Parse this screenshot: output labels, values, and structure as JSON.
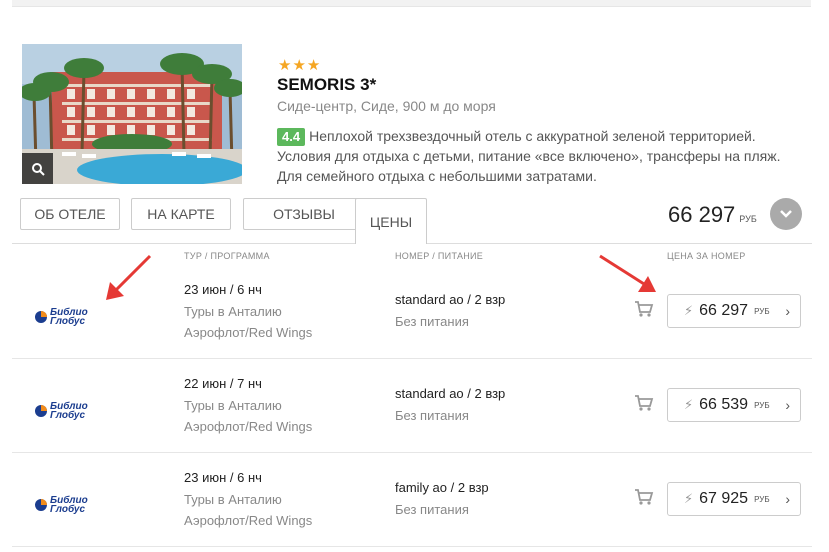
{
  "hotel": {
    "stars": "★★★",
    "name": "SEMORIS 3*",
    "location": "Сиде-центр, Сиде, 900 м до моря",
    "rating": "4.4",
    "description": "Неплохой трехзвездочный отель с аккуратной зеленой территорией. Условия для отдыха с детьми, питание «все включено», трансферы на пляж. Для семейного отдыха с небольшими затратами."
  },
  "tabs": [
    "ОБ ОТЕЛЕ",
    "НА КАРТЕ",
    "ОТЗЫВЫ",
    "ЦЕНЫ"
  ],
  "summary": {
    "price": "66 297",
    "currency": "РУБ"
  },
  "columns": {
    "tour": "ТУР / ПРОГРАММА",
    "room": "НОМЕР / ПИТАНИЕ",
    "price": "ЦЕНА ЗА НОМЕР"
  },
  "offers": [
    {
      "operator": "Библио Глобус",
      "operator_line1": "Библио",
      "operator_line2": "Глобус",
      "dates": "23 июн / 6 нч",
      "program": "Туры в Анталию",
      "airline": "Аэрофлот/Red Wings",
      "room": "standard ао / 2 взр",
      "meal": "Без питания",
      "price": "66 297",
      "currency": "РУБ"
    },
    {
      "operator": "Библио Глобус",
      "operator_line1": "Библио",
      "operator_line2": "Глобус",
      "dates": "22 июн / 7 нч",
      "program": "Туры в Анталию",
      "airline": "Аэрофлот/Red Wings",
      "room": "standard ао / 2 взр",
      "meal": "Без питания",
      "price": "66 539",
      "currency": "РУБ"
    },
    {
      "operator": "Библио Глобус",
      "operator_line1": "Библио",
      "operator_line2": "Глобус",
      "dates": "23 июн / 6 нч",
      "program": "Туры в Анталию",
      "airline": "Аэрофлот/Red Wings",
      "room": "family ао / 2 взр",
      "meal": "Без питания",
      "price": "67 925",
      "currency": "РУБ"
    }
  ],
  "colors": {
    "star": "#f5a623",
    "rating": "#5cb85c",
    "arrow": "#e53935",
    "logo_blue": "#1b3d8f",
    "logo_orange": "#f28c1b"
  },
  "icons": [
    "search-icon",
    "chevron-down-icon",
    "cart-icon",
    "bolt-icon",
    "chevron-right-icon",
    "annotation-arrow"
  ]
}
